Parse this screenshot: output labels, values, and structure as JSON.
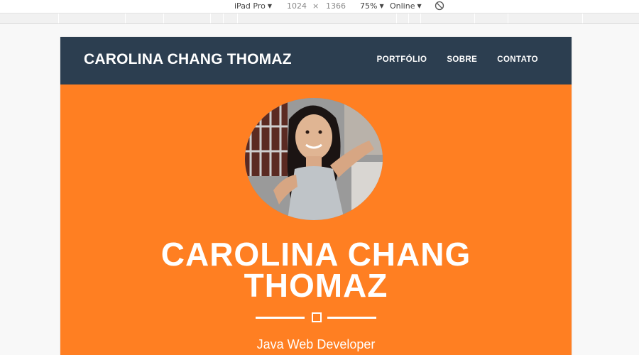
{
  "devtools": {
    "device": "iPad Pro",
    "width": "1024",
    "times": "×",
    "height": "1366",
    "zoom": "75%",
    "network": "Online"
  },
  "navbar": {
    "brand": "CAROLINA CHANG THOMAZ",
    "links": [
      "PORTFÓLIO",
      "SOBRE",
      "CONTATO"
    ]
  },
  "hero": {
    "name_line1": "CAROLINA CHANG",
    "name_line2": "THOMAZ",
    "subtitle": "Java Web Developer"
  },
  "colors": {
    "navbar": "#2c3e50",
    "hero_background": "#ff7f22",
    "text": "#ffffff"
  }
}
